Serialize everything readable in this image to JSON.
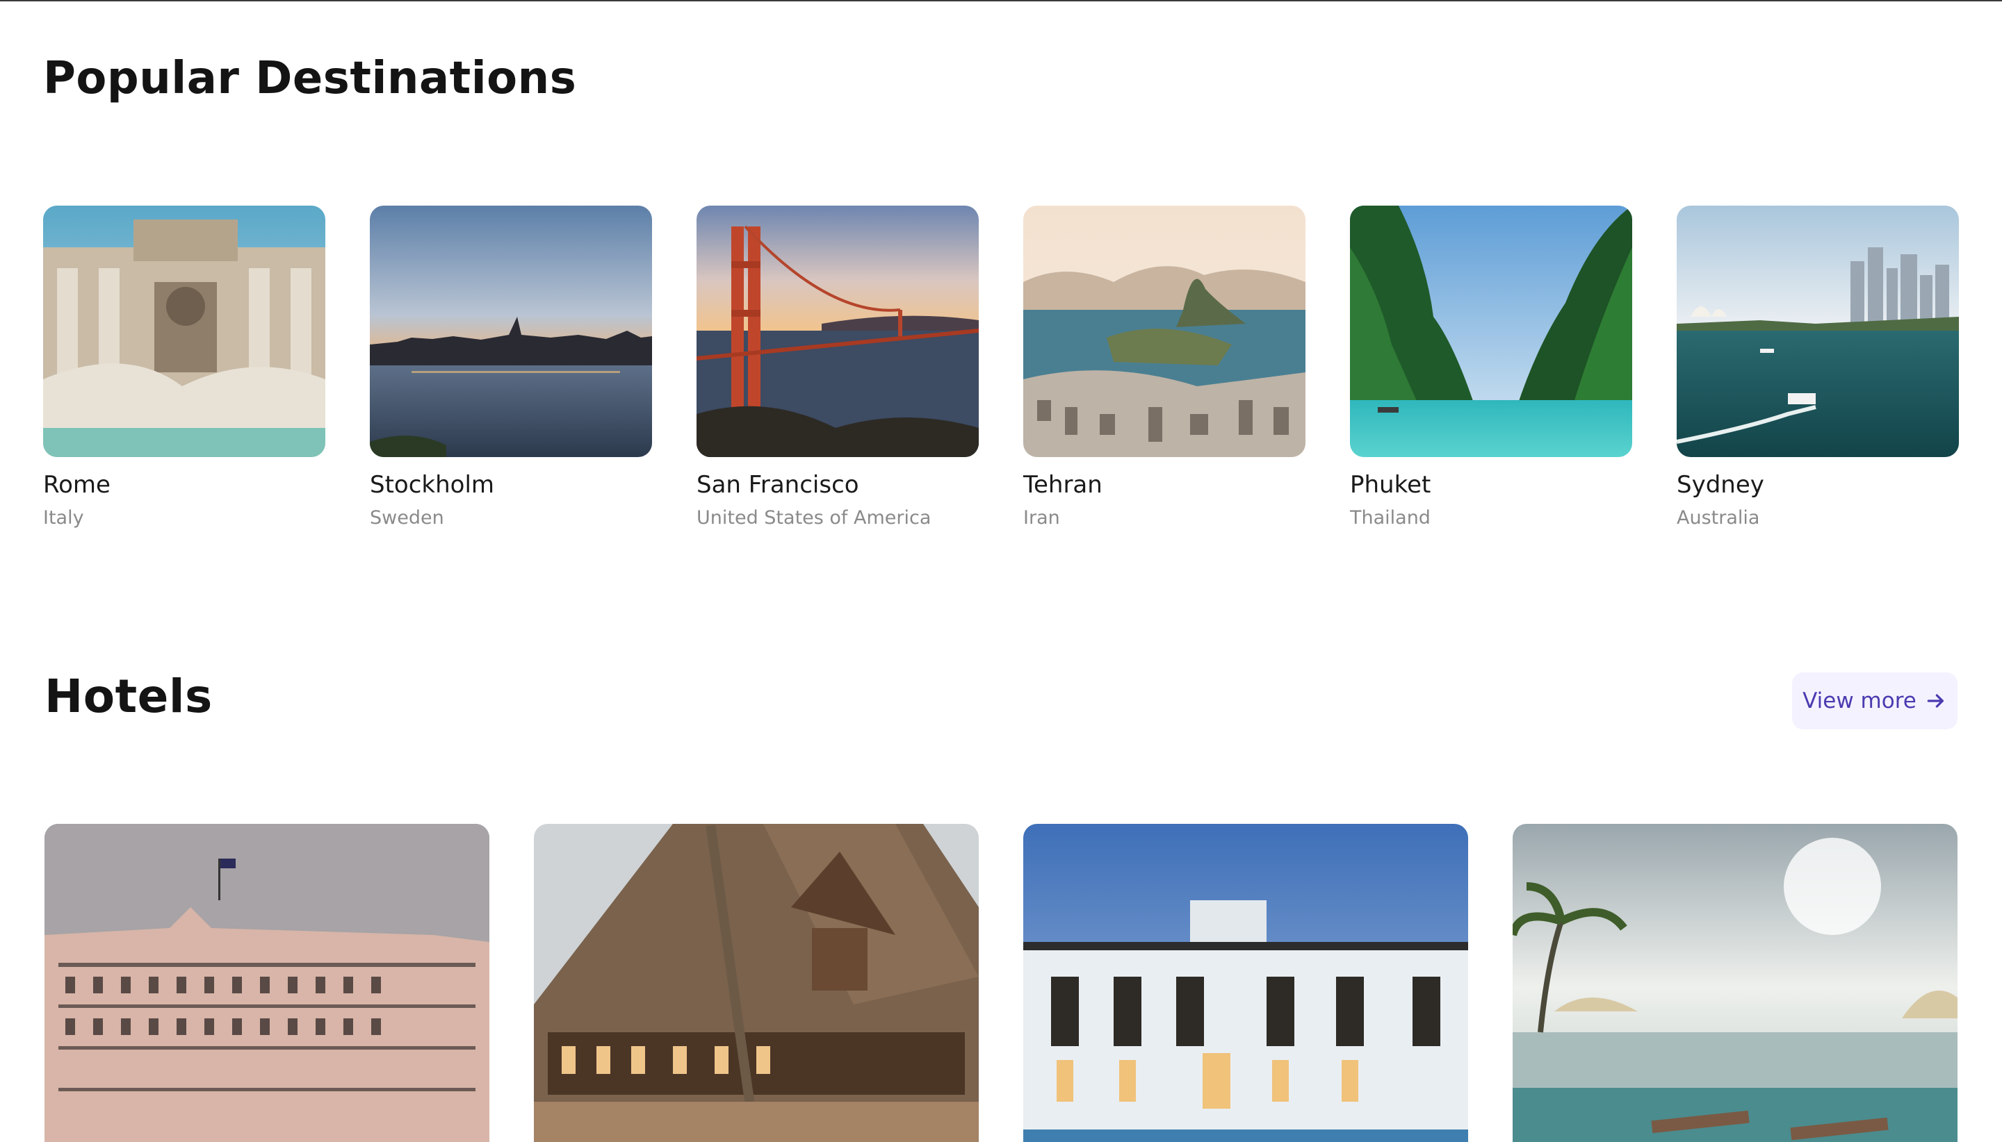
{
  "destinations": {
    "title": "Popular Destinations",
    "items": [
      {
        "name": "Rome",
        "country": "Italy"
      },
      {
        "name": "Stockholm",
        "country": "Sweden"
      },
      {
        "name": "San Francisco",
        "country": "United States of America"
      },
      {
        "name": "Tehran",
        "country": "Iran"
      },
      {
        "name": "Phuket",
        "country": "Thailand"
      },
      {
        "name": "Sydney",
        "country": "Australia"
      }
    ]
  },
  "hotels": {
    "title": "Hotels",
    "view_more_label": "View more",
    "view_more_icon": "arrow-right-icon",
    "items": [
      {
        "image": "grand-hotel-photo"
      },
      {
        "image": "wooden-lodge-photo"
      },
      {
        "image": "white-villa-photo"
      },
      {
        "image": "infinity-pool-photo"
      }
    ]
  },
  "colors": {
    "accent": "#4a3bb0",
    "accent_bg": "#f4f2ff",
    "muted_text": "#8a8a8a"
  }
}
